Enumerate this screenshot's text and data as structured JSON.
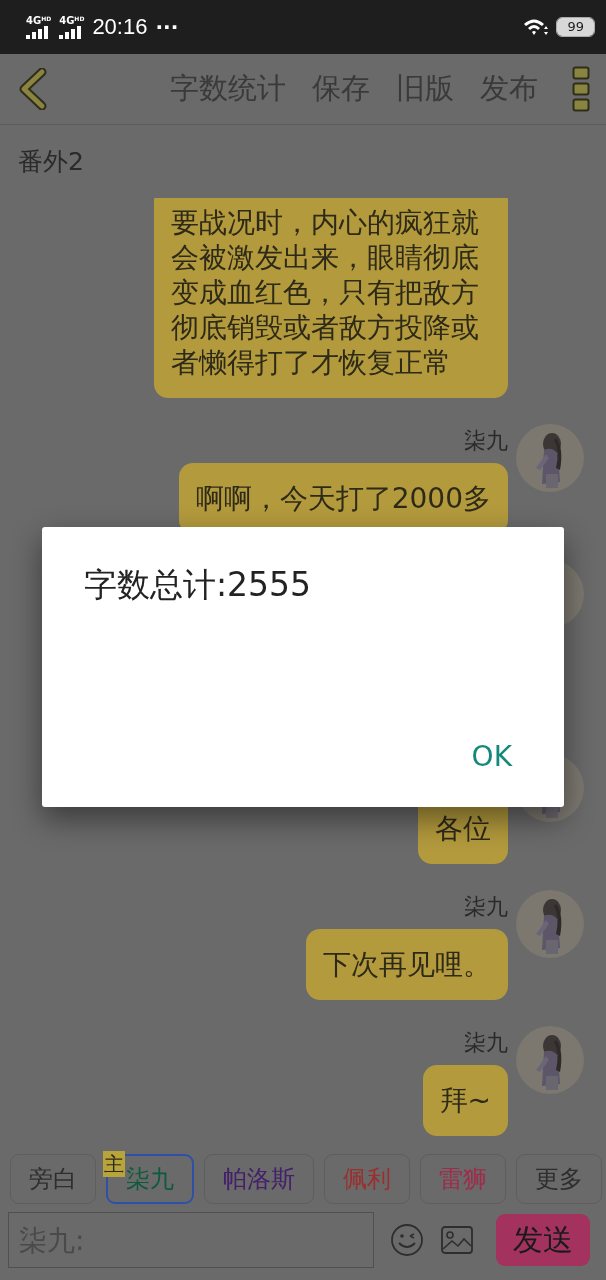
{
  "status_bar": {
    "signals": [
      {
        "label": "4G",
        "sup": "HD"
      },
      {
        "label": "4G",
        "sup": "HD"
      }
    ],
    "time": "20:16",
    "more": "···",
    "battery": "99"
  },
  "toolbar": {
    "actions": [
      "字数统计",
      "保存",
      "旧版",
      "发布"
    ]
  },
  "chapter_title": "番外2",
  "messages": [
    {
      "text": "要战况时，内心的疯狂就会被激发出来，眼睛彻底变成血红色，只有把敌方彻底销毁或者敌方投降或者懒得打了才恢复正常"
    },
    {
      "speaker": "柒九",
      "avatar": {
        "kind": "picture"
      },
      "text": "啊啊，今天打了2000多"
    },
    {
      "avatar": {
        "kind": "picture"
      }
    },
    {
      "avatar": {
        "kind": "picture"
      },
      "text": "各位"
    },
    {
      "speaker": "柒九",
      "avatar": {
        "kind": "picture"
      },
      "text": "下次再见哩。"
    },
    {
      "speaker": "柒九",
      "avatar": {
        "kind": "picture"
      },
      "text": "拜~"
    }
  ],
  "roles": [
    {
      "label": "旁白",
      "selected": false,
      "color": "#2e2e2e"
    },
    {
      "label": "柒九",
      "selected": true,
      "color": "#0e5a3e",
      "badge": "主"
    },
    {
      "label": "帕洛斯",
      "selected": false,
      "color": "#43206a"
    },
    {
      "label": "佩利",
      "selected": false,
      "color": "#9a2f2f"
    },
    {
      "label": "雷狮",
      "selected": false,
      "color": "#a02a4a"
    },
    {
      "label": "更多",
      "selected": false,
      "color": "#2e2e2e"
    }
  ],
  "composer": {
    "placeholder": "柒九:",
    "send": "发送"
  },
  "dialog": {
    "message": "字数总计:2555",
    "button": "OK"
  }
}
